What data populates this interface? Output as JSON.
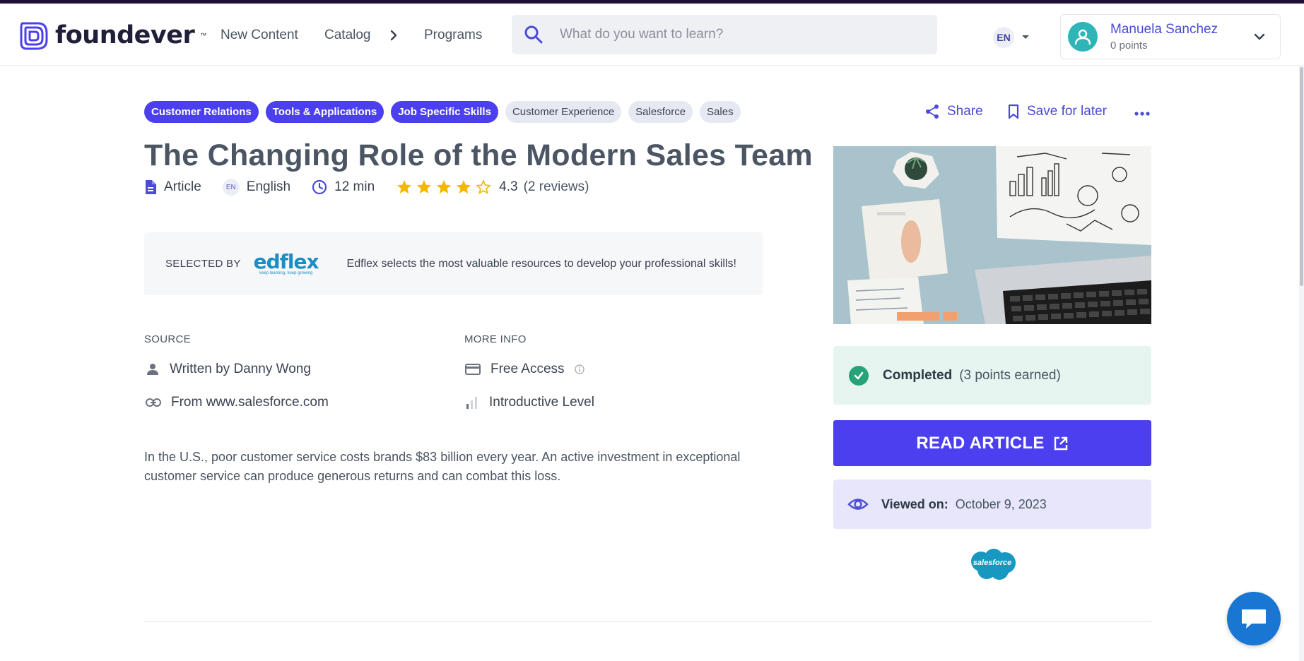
{
  "brand": {
    "name": "foundever",
    "tm": "™",
    "primary_color": "#4b3ff0"
  },
  "nav": {
    "new_content": "New Content",
    "catalog": "Catalog",
    "programs": "Programs"
  },
  "search": {
    "placeholder": "What do you want to learn?"
  },
  "language": {
    "code": "EN"
  },
  "user": {
    "name": "Manuela Sanchez",
    "points": "0 points"
  },
  "tags": {
    "primary": [
      "Customer Relations",
      "Tools & Applications",
      "Job Specific Skills"
    ],
    "secondary": [
      "Customer Experience",
      "Salesforce",
      "Sales"
    ]
  },
  "actions": {
    "share": "Share",
    "save_for_later": "Save for later"
  },
  "article": {
    "title": "The Changing Role of the Modern Sales Team",
    "type": "Article",
    "lang_code": "EN",
    "language": "English",
    "duration": "12 min",
    "rating": "4.3",
    "rating_stars": 4.3,
    "reviews": "(2 reviews)",
    "description": "In the U.S., poor customer service costs brands $83 billion every year. An active investment in exceptional customer service can produce generous returns and can combat this loss."
  },
  "selected_by": {
    "label": "SELECTED BY",
    "logo_word": "edflex",
    "logo_tagline": "keep learning, keep growing",
    "text": "Edflex selects the most valuable resources to develop your professional skills!"
  },
  "source": {
    "heading": "SOURCE",
    "author": "Written by Danny Wong",
    "from": "From www.salesforce.com"
  },
  "more_info": {
    "heading": "MORE INFO",
    "access": "Free Access",
    "level": "Introductive Level"
  },
  "status": {
    "completed": "Completed",
    "completed_sub": "(3 points earned)",
    "read_button": "READ ARTICLE",
    "viewed_label": "Viewed on:",
    "viewed_date": "October 9, 2023"
  },
  "provider": {
    "logo_text": "salesforce"
  }
}
